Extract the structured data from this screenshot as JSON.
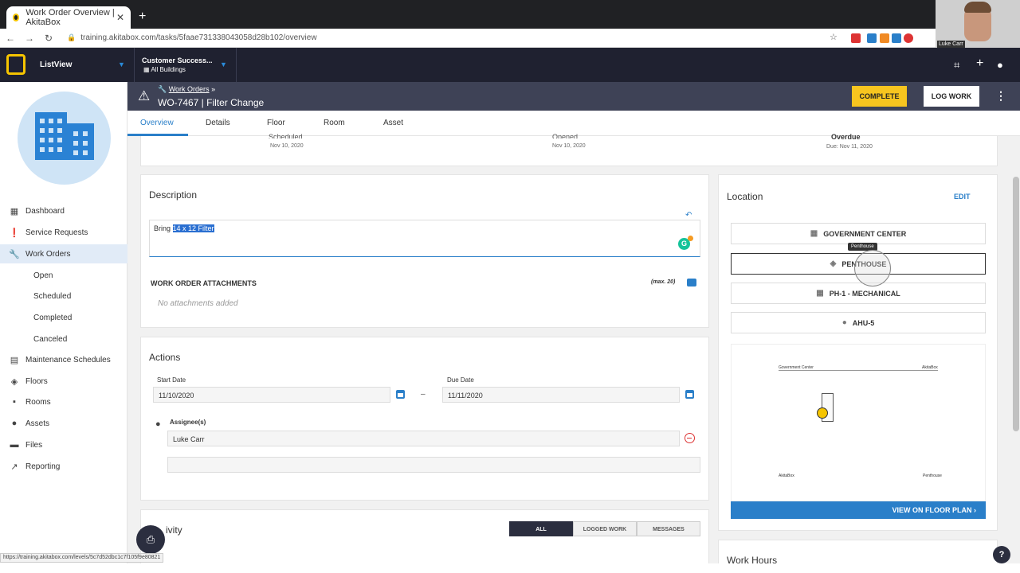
{
  "browser": {
    "tab_title": "Work Order Overview | AkitaBox",
    "url": "training.akitabox.com/tasks/5faae731338043058d28b102/overview",
    "status_url": "https://training.akitabox.com/levels/5c7d52dbc1c7f105f9e80821"
  },
  "webcam": {
    "name": "Luke Carr"
  },
  "app_header": {
    "view_label": "ListView",
    "org_name": "Customer Success...",
    "building_scope": "All Buildings"
  },
  "sidebar": {
    "items": [
      {
        "label": "Dashboard",
        "icon": "grid-icon"
      },
      {
        "label": "Service Requests",
        "icon": "alert-icon"
      },
      {
        "label": "Work Orders",
        "icon": "wrench-icon"
      },
      {
        "label": "Maintenance Schedules",
        "icon": "calendar-icon"
      },
      {
        "label": "Floors",
        "icon": "layers-icon"
      },
      {
        "label": "Rooms",
        "icon": "room-icon"
      },
      {
        "label": "Assets",
        "icon": "pin-icon"
      },
      {
        "label": "Files",
        "icon": "folder-icon"
      },
      {
        "label": "Reporting",
        "icon": "chart-icon"
      }
    ],
    "sub_items": [
      "Open",
      "Scheduled",
      "Completed",
      "Canceled"
    ]
  },
  "page_header": {
    "breadcrumb": "Work Orders",
    "breadcrumb_sep": "»",
    "title": "WO-7467 | Filter Change",
    "complete_label": "COMPLETE",
    "log_work_label": "LOG WORK"
  },
  "tabs": [
    "Overview",
    "Details",
    "Floor",
    "Room",
    "Asset"
  ],
  "summary": {
    "scheduled_label": "Scheduled",
    "scheduled_date": "Nov 10, 2020",
    "opened_label": "Opened",
    "opened_date": "Nov 10, 2020",
    "status_label": "Overdue",
    "due_text": "Due: Nov 11, 2020"
  },
  "description": {
    "title": "Description",
    "text_plain": "Bring ",
    "text_selected": "14 x 12 Filter",
    "grammarly_badge": "G",
    "attachments_title": "WORK ORDER ATTACHMENTS",
    "attachments_max": "(max. 20)",
    "no_attachments": "No attachments added"
  },
  "actions": {
    "title": "Actions",
    "start_date_label": "Start Date",
    "start_date": "11/10/2020",
    "date_separator": "–",
    "due_date_label": "Due Date",
    "due_date": "11/11/2020",
    "assignees_label": "Assignee(s)",
    "assignee": "Luke Carr"
  },
  "activity": {
    "title_partial": "ivity",
    "filters": [
      "ALL",
      "LOGGED WORK",
      "MESSAGES"
    ],
    "active_filter": "ALL"
  },
  "location": {
    "title": "Location",
    "edit_label": "EDIT",
    "building": "GOVERNMENT CENTER",
    "floor": "PENTHOUSE",
    "floor_tooltip": "Penthouse",
    "room": "PH-1 - MECHANICAL",
    "asset": "AHU-5",
    "view_floor_plan": "VIEW ON FLOOR PLAN",
    "plan_header_left": "Government Center",
    "plan_header_right": "AkitaBox",
    "plan_footer_left": "AkitaBox",
    "plan_footer_right": "Penthouse"
  },
  "work_hours": {
    "title": "Work Hours"
  },
  "colors": {
    "accent": "#2a7fc9",
    "complete_button": "#f7c51f",
    "header_dark": "#1f2130",
    "page_header": "#3e4256"
  }
}
